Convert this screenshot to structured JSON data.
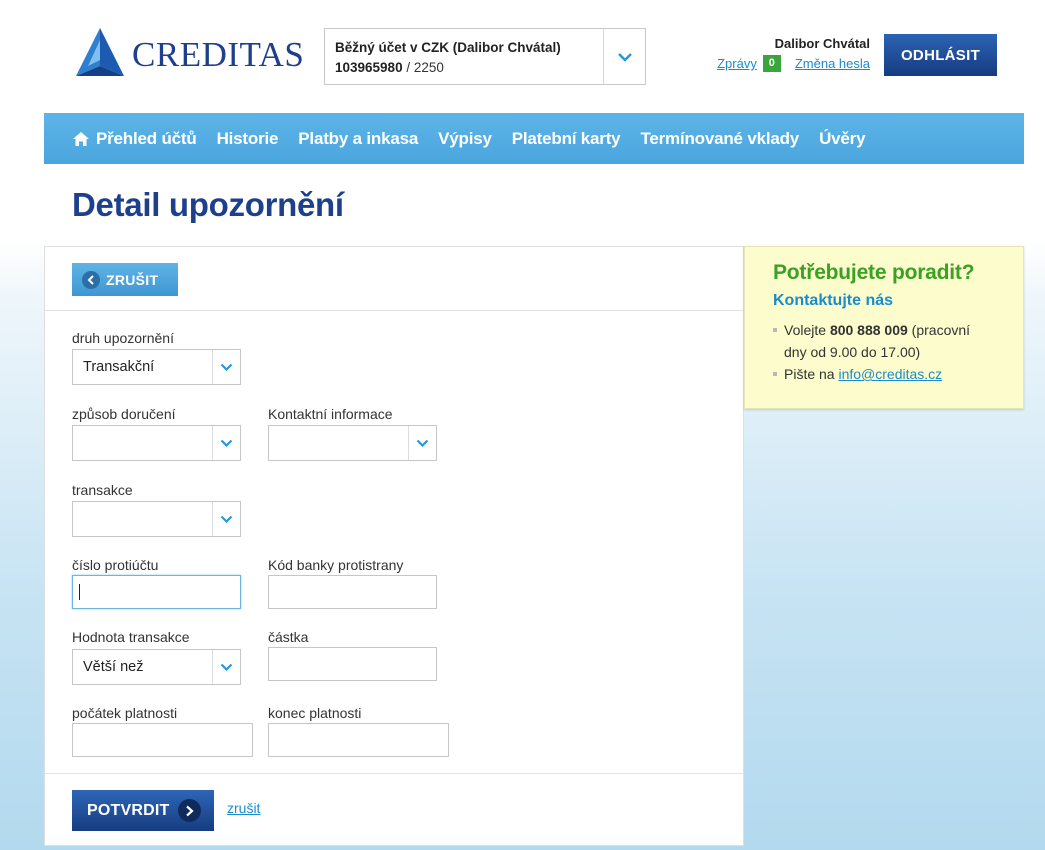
{
  "header": {
    "logo_text": "CREDITAS",
    "account": {
      "name": "Běžný účet v CZK (Dalibor Chvátal)",
      "number": "103965980",
      "bank_code": "/ 2250"
    },
    "user_name": "Dalibor Chvátal",
    "messages_label": "Zprávy",
    "messages_count": "0",
    "change_password_label": "Změna hesla",
    "logout_label": "ODHLÁSIT"
  },
  "nav": {
    "items": [
      "Přehled účtů",
      "Historie",
      "Platby a inkasa",
      "Výpisy",
      "Platební karty",
      "Termínované vklady",
      "Úvěry"
    ]
  },
  "page": {
    "title": "Detail upozornění"
  },
  "form": {
    "cancel_top_label": "ZRUŠIT",
    "alert_type": {
      "label": "druh upozornění",
      "value": "Transakční"
    },
    "delivery_method": {
      "label": "způsob doručení",
      "value": ""
    },
    "contact_info": {
      "label": "Kontaktní informace",
      "value": ""
    },
    "transaction": {
      "label": "transakce",
      "value": ""
    },
    "counter_account": {
      "label": "číslo protiúčtu",
      "value": ""
    },
    "counter_bank_code": {
      "label": "Kód banky protistrany",
      "value": ""
    },
    "transaction_value": {
      "label": "Hodnota transakce",
      "value": "Větší než"
    },
    "amount": {
      "label": "částka",
      "value": ""
    },
    "valid_from": {
      "label": "počátek platnosti",
      "value": ""
    },
    "valid_to": {
      "label": "konec platnosti",
      "value": ""
    },
    "confirm_label": "POTVRDIT",
    "cancel_link_label": "zrušit"
  },
  "help": {
    "title": "Potřebujete poradit?",
    "subtitle": "Kontaktujte nás",
    "call_prefix": "Volejte ",
    "phone": "800 888 009",
    "call_suffix": " (pracovní dny od 9.00 do 17.00)",
    "write_prefix": "Pište na ",
    "email": "info@creditas.cz"
  },
  "colors": {
    "brand_blue": "#1d3f8c",
    "nav_blue": "#4aa6de",
    "link_blue": "#1a8ccb",
    "help_green": "#3aa124",
    "help_bg": "#fcfccd"
  }
}
